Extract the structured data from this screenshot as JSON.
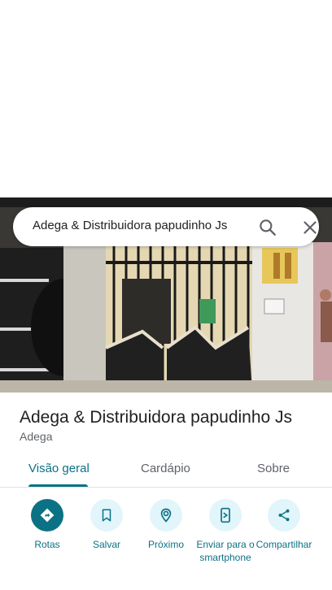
{
  "search": {
    "query": "Adega & Distribuidora papudinho Js"
  },
  "place": {
    "name": "Adega & Distribuidora papudinho Js",
    "category": "Adega"
  },
  "tabs": [
    {
      "label": "Visão geral",
      "active": true
    },
    {
      "label": "Cardápio",
      "active": false
    },
    {
      "label": "Sobre",
      "active": false
    }
  ],
  "actions": [
    {
      "label": "Rotas",
      "icon": "directions-icon"
    },
    {
      "label": "Salvar",
      "icon": "bookmark-icon"
    },
    {
      "label": "Próximo",
      "icon": "nearby-icon"
    },
    {
      "label": "Enviar para o smartphone",
      "icon": "send-to-phone-icon"
    },
    {
      "label": "Compartilhar",
      "icon": "share-icon"
    }
  ],
  "colors": {
    "accent": "#0b7285",
    "action_bg": "#e1f5fb"
  }
}
